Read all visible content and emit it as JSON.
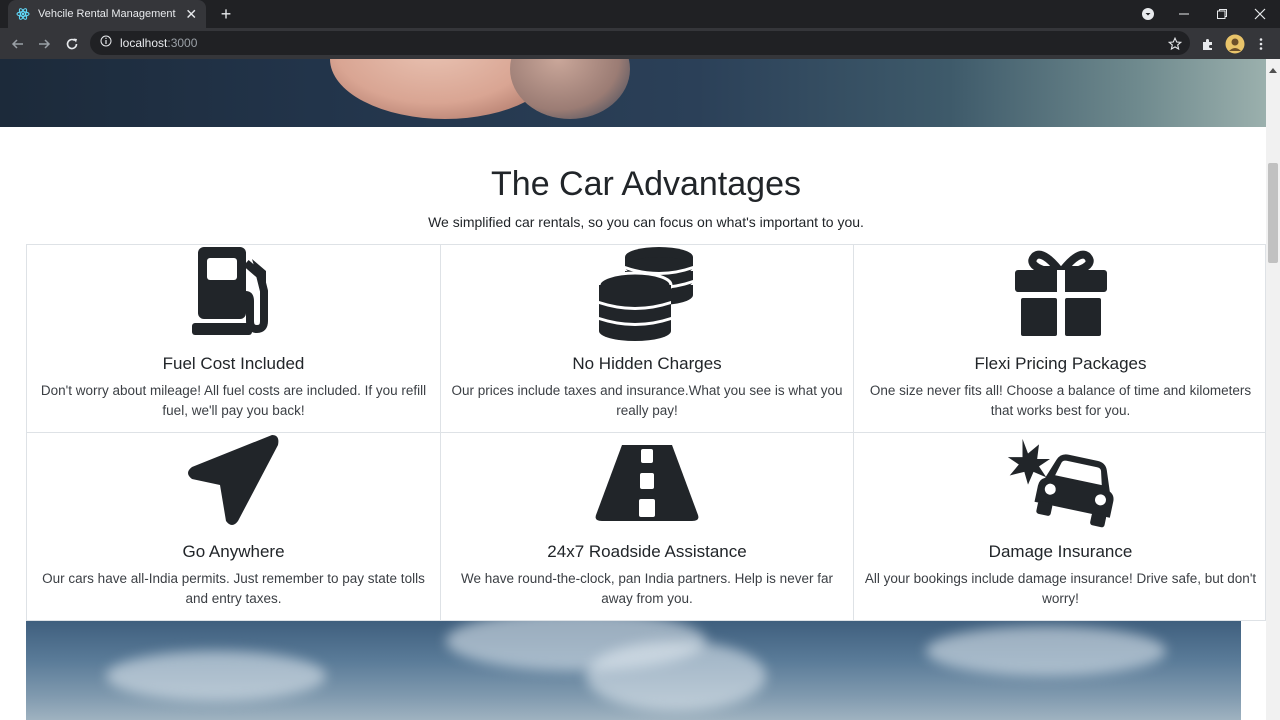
{
  "browser": {
    "tab_title": "Vehcile Rental Management System",
    "url_host": "localhost",
    "url_port": ":3000"
  },
  "section": {
    "title": "The Car Advantages",
    "subtitle": "We simplified car rentals, so you can focus on what's important to you."
  },
  "features": [
    {
      "icon": "fuel-pump-icon",
      "title": "Fuel Cost Included",
      "text": "Don't worry about mileage! All fuel costs are included. If you refill fuel, we'll pay you back!"
    },
    {
      "icon": "coins-icon",
      "title": "No Hidden Charges",
      "text": "Our prices include taxes and insurance.What you see is what you really pay!"
    },
    {
      "icon": "gift-icon",
      "title": "Flexi Pricing Packages",
      "text": "One size never fits all! Choose a balance of time and kilometers that works best for you."
    },
    {
      "icon": "location-arrow-icon",
      "title": "Go Anywhere",
      "text": "Our cars have all-India permits. Just remember to pay state tolls and entry taxes."
    },
    {
      "icon": "road-icon",
      "title": "24x7 Roadside Assistance",
      "text": "We have round-the-clock, pan India partners. Help is never far away from you."
    },
    {
      "icon": "car-crash-icon",
      "title": "Damage Insurance",
      "text": "All your bookings include damage insurance! Drive safe, but don't worry!"
    }
  ],
  "colors": {
    "text": "#212529",
    "chrome_dark": "#202124",
    "chrome_mid": "#35363a"
  }
}
